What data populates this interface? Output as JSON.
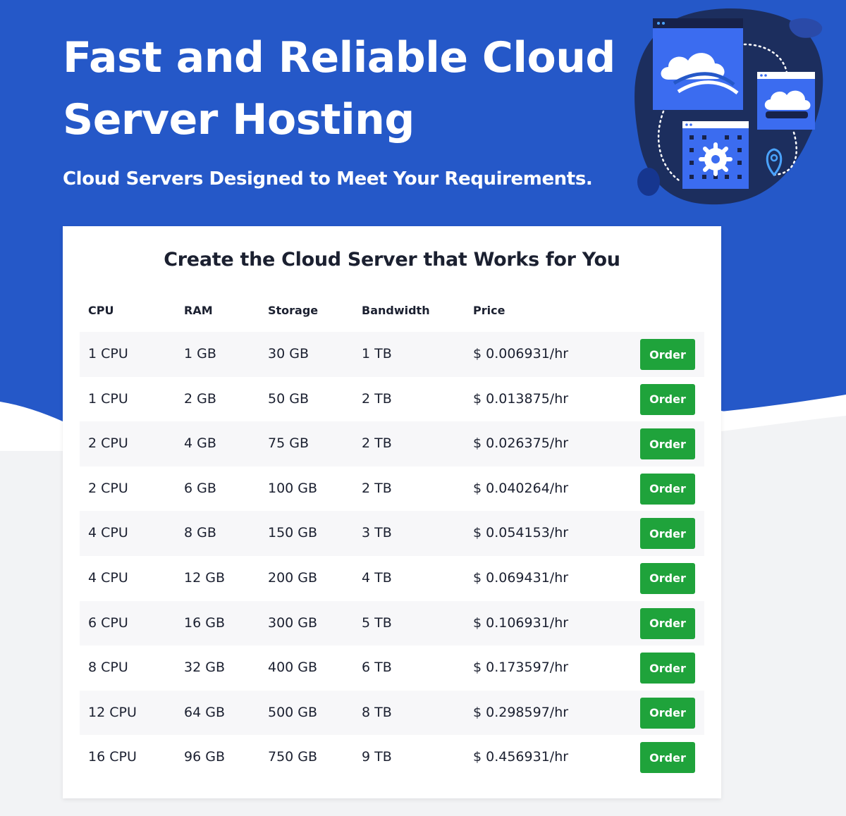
{
  "hero": {
    "title_line1": "Fast and Reliable Cloud",
    "title_line2": "Server Hosting",
    "subtitle": "Cloud Servers Designed to Meet Your Requirements.",
    "background_color": "#2558c8",
    "illustration": {
      "blob_color": "#1c2e5e",
      "icons": [
        "cloud-window-icon",
        "cloud-storage-icon",
        "server-gear-icon",
        "location-pin-icon"
      ]
    }
  },
  "pricing": {
    "title": "Create the Cloud Server that Works for You",
    "columns": [
      "CPU",
      "RAM",
      "Storage",
      "Bandwidth",
      "Price"
    ],
    "order_label": "Order",
    "button_color": "#1fa33b",
    "rows": [
      {
        "cpu": "1 CPU",
        "ram": "1 GB",
        "storage": "30 GB",
        "bandwidth": "1 TB",
        "price": "$ 0.006931/hr"
      },
      {
        "cpu": "1 CPU",
        "ram": "2 GB",
        "storage": "50 GB",
        "bandwidth": "2 TB",
        "price": "$ 0.013875/hr"
      },
      {
        "cpu": "2 CPU",
        "ram": "4 GB",
        "storage": "75 GB",
        "bandwidth": "2 TB",
        "price": "$ 0.026375/hr"
      },
      {
        "cpu": "2 CPU",
        "ram": "6 GB",
        "storage": "100 GB",
        "bandwidth": "2 TB",
        "price": "$ 0.040264/hr"
      },
      {
        "cpu": "4 CPU",
        "ram": "8 GB",
        "storage": "150 GB",
        "bandwidth": "3 TB",
        "price": "$ 0.054153/hr"
      },
      {
        "cpu": "4 CPU",
        "ram": "12 GB",
        "storage": "200 GB",
        "bandwidth": "4 TB",
        "price": "$ 0.069431/hr"
      },
      {
        "cpu": "6 CPU",
        "ram": "16 GB",
        "storage": "300 GB",
        "bandwidth": "5 TB",
        "price": "$ 0.106931/hr"
      },
      {
        "cpu": "8 CPU",
        "ram": "32 GB",
        "storage": "400 GB",
        "bandwidth": "6 TB",
        "price": "$ 0.173597/hr"
      },
      {
        "cpu": "12 CPU",
        "ram": "64 GB",
        "storage": "500 GB",
        "bandwidth": "8 TB",
        "price": "$ 0.298597/hr"
      },
      {
        "cpu": "16 CPU",
        "ram": "96 GB",
        "storage": "750 GB",
        "bandwidth": "9 TB",
        "price": "$ 0.456931/hr"
      }
    ]
  }
}
